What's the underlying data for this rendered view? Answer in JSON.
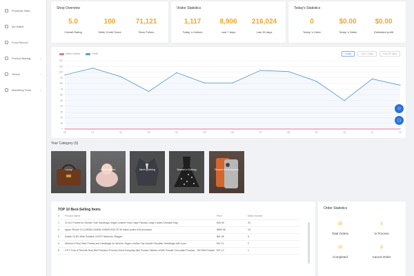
{
  "sidebar": {
    "items": [
      {
        "label": "Financial State..."
      },
      {
        "label": "My Wallet"
      },
      {
        "label": "Fund Record"
      },
      {
        "label": "Product Manag..."
      },
      {
        "label": "Others"
      },
      {
        "label": "Marketing Tools"
      }
    ]
  },
  "shop_overview": {
    "title": "Shop Overview",
    "stats": [
      {
        "value": "5.0",
        "label": "Overall Rating"
      },
      {
        "value": "100",
        "label": "Seller Credit Score"
      },
      {
        "value": "71,121",
        "label": "Store Follow"
      }
    ]
  },
  "visitor_statistics": {
    "title": "Visitor Statistics",
    "stats": [
      {
        "value": "1,117",
        "label": "Today' s Visitors"
      },
      {
        "value": "8,906",
        "label": "Last 7 days"
      },
      {
        "value": "216,024",
        "label": "Last 30 days"
      }
    ]
  },
  "todays_statistics": {
    "title": "Today's Statistics",
    "stats": [
      {
        "value": "0",
        "label": "Today' s Order"
      },
      {
        "value": "$0.00",
        "label": "Today' s Sales"
      },
      {
        "value": "$0.00",
        "label": "Estimated profit"
      }
    ]
  },
  "chart": {
    "legend": [
      "Sales Volume",
      "Profit"
    ],
    "tabs": [
      "Today",
      "Last 7 days",
      "Last 30 days"
    ],
    "colors": {
      "sales": "#e8748a",
      "profit": "#5b9bd5"
    }
  },
  "chart_data": {
    "type": "line",
    "x": [
      "00",
      "01",
      "02",
      "03",
      "04",
      "05",
      "06",
      "07",
      "08",
      "09",
      "10",
      "11",
      "12"
    ],
    "series": [
      {
        "name": "Profit",
        "values": [
          95,
          107,
          92,
          66,
          99,
          81,
          81,
          103,
          101,
          84,
          50,
          88,
          77
        ]
      },
      {
        "name": "Sales Volume",
        "values": [
          0,
          0,
          0,
          0,
          0,
          0,
          0,
          0,
          0,
          0,
          0,
          0,
          0
        ]
      }
    ],
    "yticks": [
      "0",
      "10",
      "20",
      "30",
      "40",
      "50",
      "60",
      "70",
      "80",
      "90",
      "100",
      "110",
      "120"
    ],
    "ylim": [
      0,
      120
    ]
  },
  "category": {
    "title": "Your Category",
    "count": "(5)",
    "items": [
      {
        "label": "Luxury"
      },
      {
        "label": "Kids & Babies"
      },
      {
        "label": "Men's Clothing"
      },
      {
        "label": "Women's Clothing"
      },
      {
        "label": "Phones & Accessories"
      }
    ]
  },
  "top10": {
    "title": "TOP 10 Best-Selling Items",
    "headers": [
      "#",
      "Product Name",
      "Price",
      "Sales Volume"
    ],
    "rows": [
      [
        "1",
        "CLUCI Purses for Women Tote Handbags Vegan Leather Hobo Vape Fashion Large Ladies Shoulder Bag",
        "$26.99",
        "20"
      ],
      [
        "2",
        "Apple iPhone 15 (128GB) 15/8GB 15/8GB 5G/LTE 60 billion pixels A16 processor",
        "$899.98",
        "16"
      ],
      [
        "3",
        "Switch OLED With Portable 2/16TF Nintendo 256gpm",
        "$61.95",
        "5"
      ],
      [
        "4",
        "Women's Real Velor Purses and Handbags for Women Vegan Leather Top Handle Shoulder Handbags with 6 pcs",
        "$37.11",
        "2"
      ],
      [
        "5",
        "CITY Fore & Remote Dual Met Precision Process Grind Everyday Milk Powder Tablets of Milk Powder Chocolate Produce - 150 Milk Powder",
        "$27.12",
        "1"
      ]
    ]
  },
  "order_statistics": {
    "title": "Order Statistics",
    "stats": [
      {
        "value": "35",
        "label": "Total Orders"
      },
      {
        "value": "5",
        "label": "In Process"
      },
      {
        "value": "10",
        "label": "Completed"
      },
      {
        "value": "9",
        "label": "Cancel Order"
      }
    ]
  }
}
